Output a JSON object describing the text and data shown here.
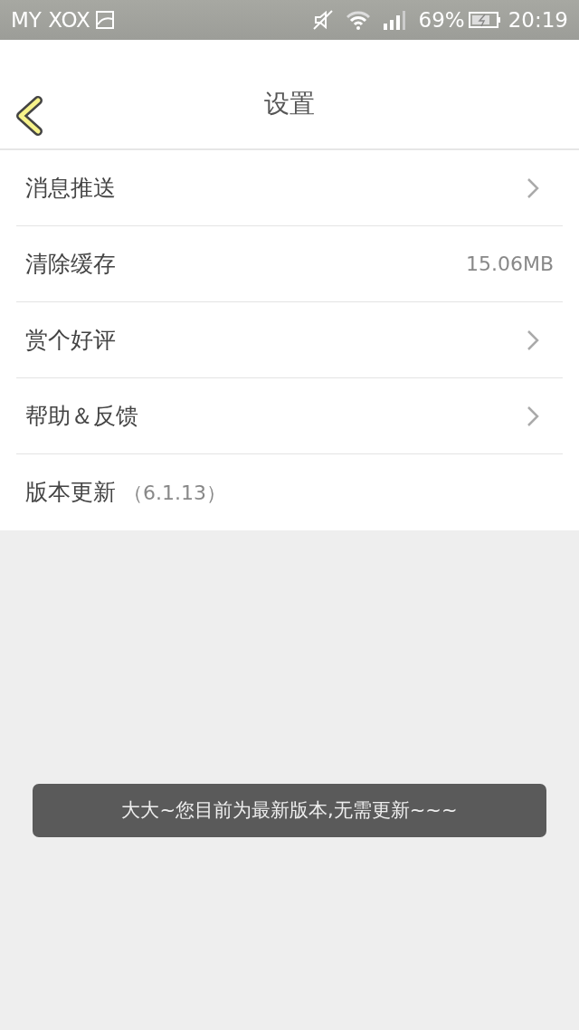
{
  "status_bar": {
    "carrier": "MY XOX",
    "battery": "69%",
    "time": "20:19"
  },
  "header": {
    "title": "设置"
  },
  "items": [
    {
      "kind": "chevron",
      "label": "消息推送"
    },
    {
      "kind": "value",
      "label": "清除缓存",
      "value": "15.06MB"
    },
    {
      "kind": "chevron",
      "label": "赏个好评"
    },
    {
      "kind": "chevron",
      "label": "帮助＆反馈"
    },
    {
      "kind": "version",
      "label": "版本更新",
      "value": "（6.1.13）"
    }
  ],
  "toast": {
    "text": "大大~您目前为最新版本,无需更新~~~"
  }
}
